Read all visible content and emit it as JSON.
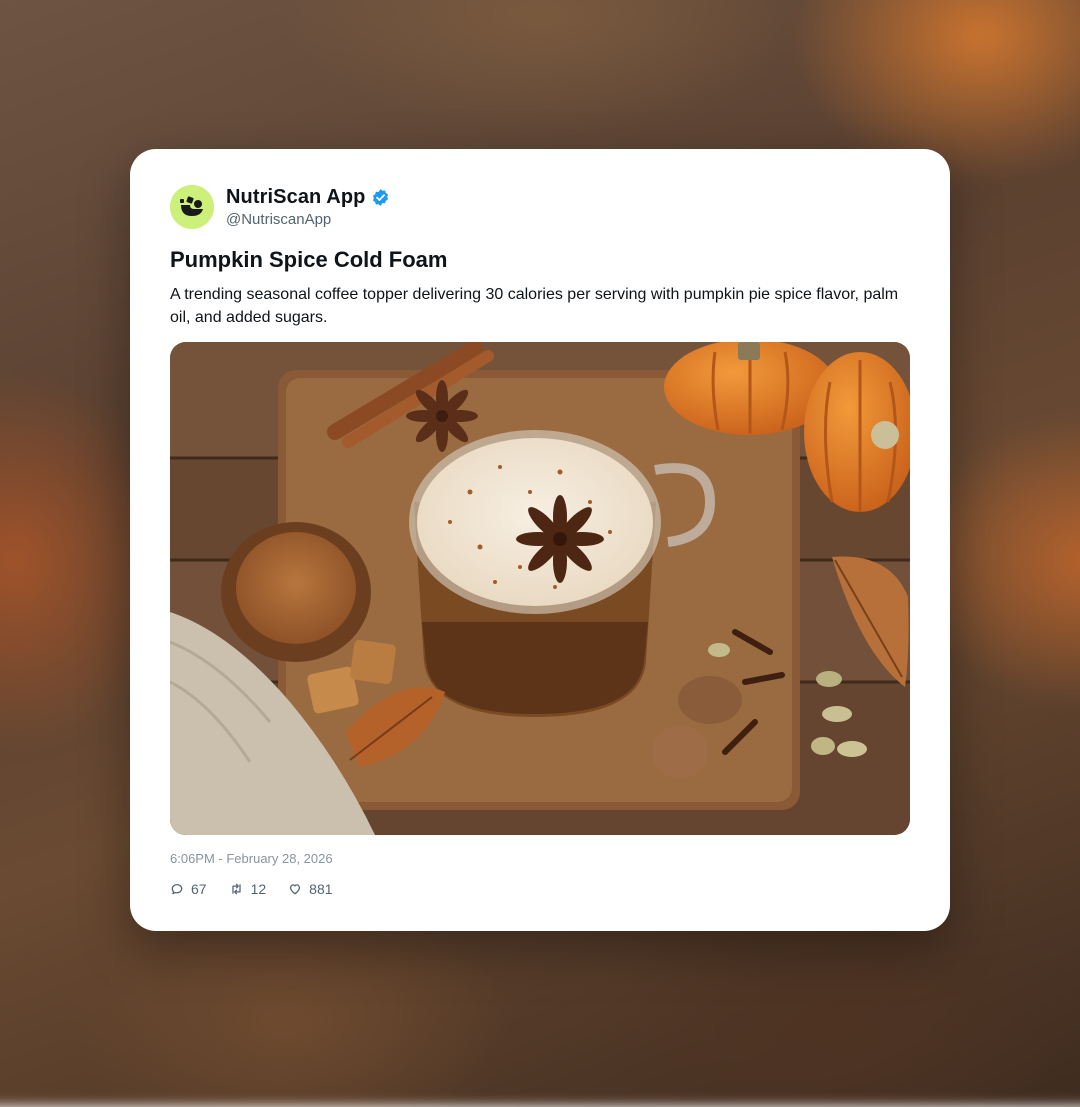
{
  "post": {
    "display_name": "NutriScan App",
    "handle": "@NutriscanApp",
    "verified": true,
    "title": "Pumpkin Spice Cold Foam",
    "body": "A trending seasonal coffee topper delivering 30 calories per serving with pumpkin pie spice flavor, palm oil, and added sugars.",
    "timestamp": "6:06PM - February 28, 2026"
  },
  "stats": {
    "replies": "67",
    "reposts": "12",
    "likes": "881"
  },
  "icons": {
    "avatar": "nutriscan-logo",
    "verified": "verified-badge-icon",
    "reply": "comment-icon",
    "repost": "repost-icon",
    "like": "heart-icon"
  },
  "colors": {
    "accent_verified": "#1d9bf0",
    "avatar_bg": "#cdf07a",
    "text_primary": "#0f1419",
    "text_secondary": "#536471"
  }
}
